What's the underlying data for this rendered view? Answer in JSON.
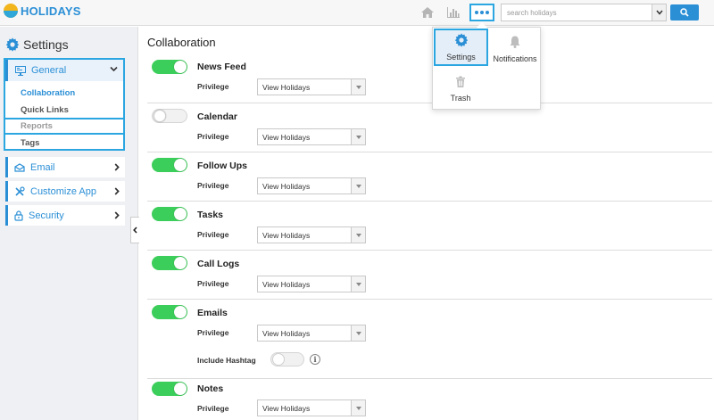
{
  "app": {
    "brand": "HOLIDAYS"
  },
  "topbar": {
    "search_placeholder": "search holidays"
  },
  "menu": {
    "items": [
      {
        "label": "Settings",
        "icon": "gear-icon"
      },
      {
        "label": "Notifications",
        "icon": "bell-icon"
      },
      {
        "label": "Trash",
        "icon": "trash-icon"
      }
    ]
  },
  "sidebar": {
    "title": "Settings",
    "general": {
      "label": "General",
      "children": [
        "Collaboration",
        "Quick Links",
        "Reports",
        "Tags"
      ]
    },
    "items": [
      {
        "label": "Email",
        "icon": "envelope-icon"
      },
      {
        "label": "Customize App",
        "icon": "tools-icon"
      },
      {
        "label": "Security",
        "icon": "lock-icon"
      }
    ]
  },
  "main": {
    "title": "Collaboration",
    "privilege_label": "Privilege",
    "include_hashtag_label": "Include Hashtag",
    "include_hashtag_enabled": false,
    "rows": [
      {
        "title": "News Feed",
        "enabled": true,
        "privilege": "View Holidays"
      },
      {
        "title": "Calendar",
        "enabled": false,
        "privilege": "View Holidays"
      },
      {
        "title": "Follow Ups",
        "enabled": true,
        "privilege": "View Holidays"
      },
      {
        "title": "Tasks",
        "enabled": true,
        "privilege": "View Holidays"
      },
      {
        "title": "Call Logs",
        "enabled": true,
        "privilege": "View Holidays"
      },
      {
        "title": "Emails",
        "enabled": true,
        "privilege": "View Holidays"
      },
      {
        "title": "Notes",
        "enabled": true,
        "privilege": "View Holidays"
      }
    ]
  },
  "colors": {
    "accent": "#2b8fd6",
    "highlight_border": "#2ba6e1",
    "toggle_on": "#3cce5a"
  }
}
